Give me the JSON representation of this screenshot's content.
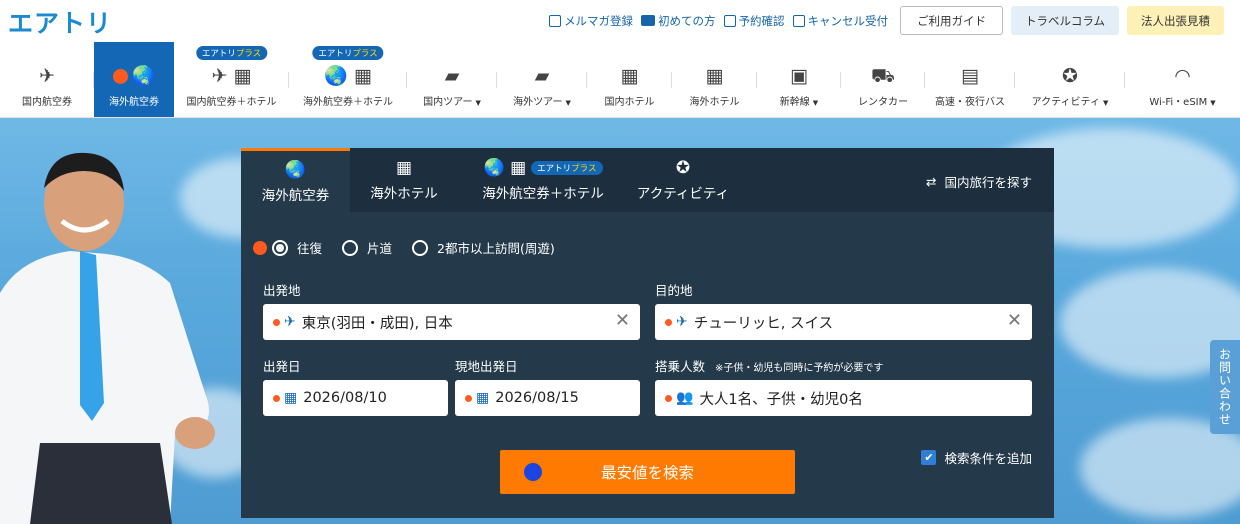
{
  "brand": {
    "logo": "エアトリ",
    "accent": "#1467b4",
    "orange": "#ff7a00"
  },
  "header": {
    "links": [
      {
        "icon": "mail-icon",
        "label": "メルマガ登録"
      },
      {
        "icon": "new-icon",
        "label": "初めての方"
      },
      {
        "icon": "calendar-icon",
        "label": "予約確認"
      },
      {
        "icon": "cancel-calendar-icon",
        "label": "キャンセル受付"
      }
    ],
    "guide": "ご利用ガイド",
    "column": "トラベルコラム",
    "business": "法人出張見積"
  },
  "nav": {
    "plus_badge_pre": "エアトリ",
    "plus_badge_post": "プラス",
    "items": [
      {
        "label": "国内航空券",
        "icon": "airplane-icon"
      },
      {
        "label": "海外航空券",
        "icon": "globe-plane-icon"
      },
      {
        "label": "国内航空券＋ホテル",
        "icon": "plane-hotel-icon"
      },
      {
        "label": "海外航空券＋ホテル",
        "icon": "globe-hotel-icon"
      },
      {
        "label": "国内ツアー",
        "icon": "suitcase-icon"
      },
      {
        "label": "海外ツアー",
        "icon": "suitcase-icon"
      },
      {
        "label": "国内ホテル",
        "icon": "hotel-icon"
      },
      {
        "label": "海外ホテル",
        "icon": "hotel-icon"
      },
      {
        "label": "新幹線",
        "icon": "train-icon"
      },
      {
        "label": "レンタカー",
        "icon": "car-icon"
      },
      {
        "label": "高速・夜行バス",
        "icon": "bus-icon"
      },
      {
        "label": "アクティビティ",
        "icon": "activity-icon"
      },
      {
        "label": "Wi-Fi・eSIM",
        "icon": "wifi-icon"
      }
    ]
  },
  "side_tab": "お問い合わせ",
  "search": {
    "tabs": [
      "海外航空券",
      "海外ホテル",
      "海外航空券＋ホテル",
      "アクティビティ"
    ],
    "domestic_link": "国内旅行を探す",
    "trip_types": [
      "往復",
      "片道",
      "2都市以上訪問(周遊)"
    ],
    "origin_label": "出発地",
    "origin_value": "東京(羽田・成田), 日本",
    "dest_label": "目的地",
    "dest_value": "チューリッヒ, スイス",
    "depart_label": "出発日",
    "depart_value": "2026/08/10",
    "return_label": "現地出発日",
    "return_value": "2026/08/15",
    "pax_label": "搭乗人数",
    "pax_note": "※子供・幼児も同時に予約が必要です",
    "pax_value": "大人1名、子供・幼児0名",
    "search_button": "最安値を検索",
    "add_conditions": "検索条件を追加"
  }
}
